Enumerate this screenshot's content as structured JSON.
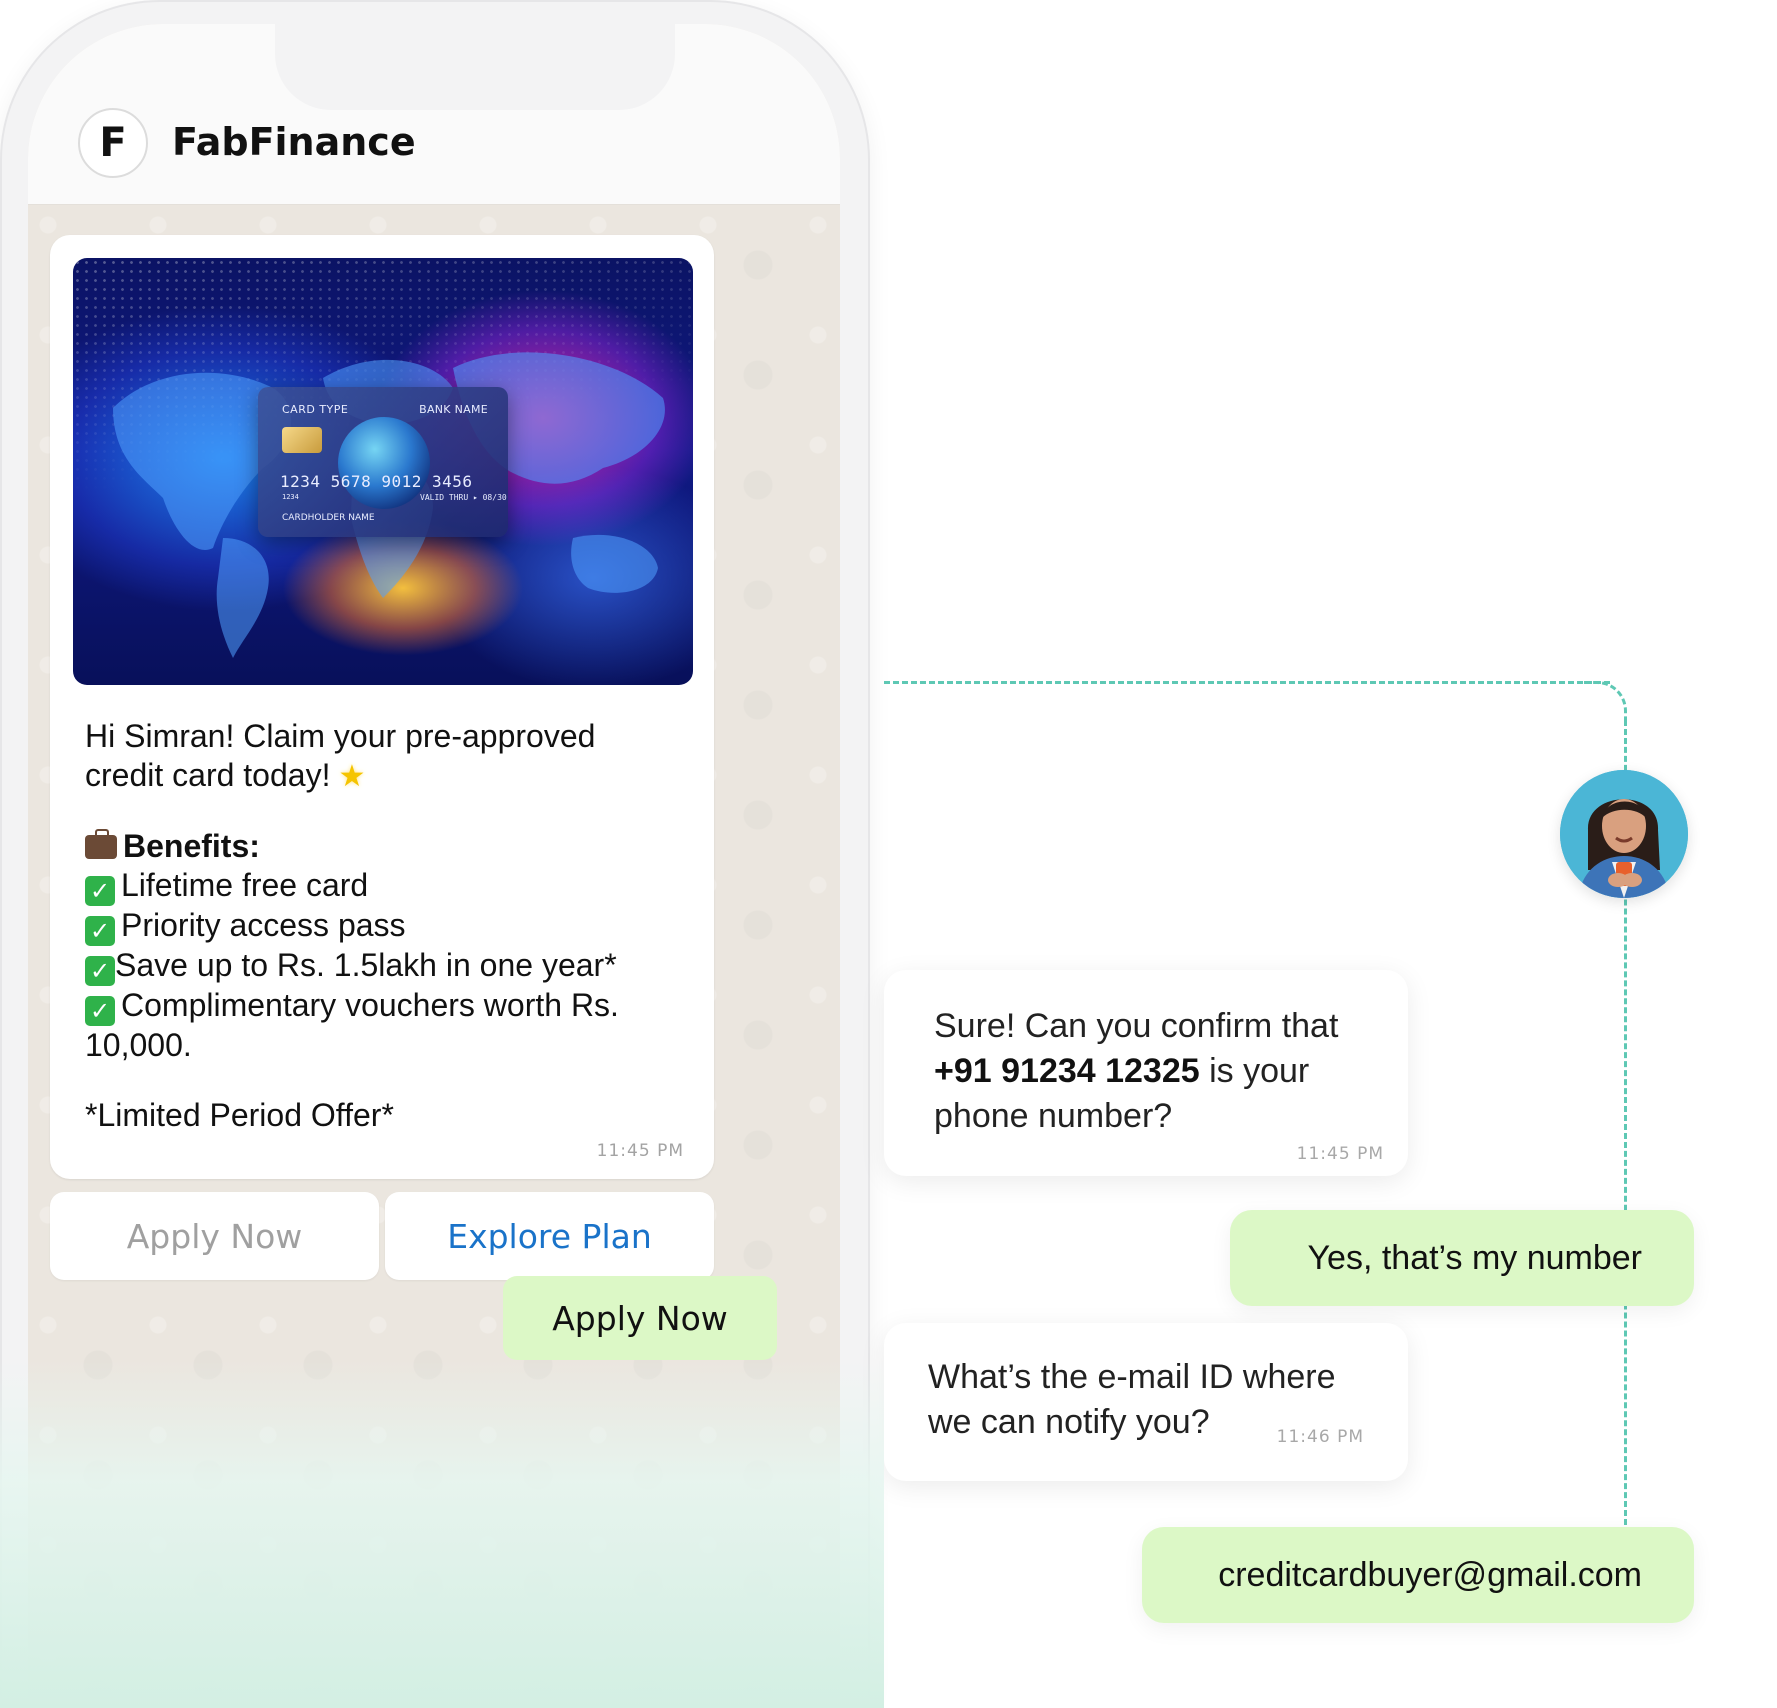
{
  "header": {
    "avatar_letter": "F",
    "brand_name": "FabFinance"
  },
  "card_image": {
    "card_type": "CARD TYPE",
    "bank_name": "BANK NAME",
    "number": "1234  5678  9012  3456",
    "sub_number": "1234",
    "valid_thru": "VALID THRU ▸ 08/30",
    "holder": "CARDHOLDER NAME"
  },
  "offer": {
    "greeting_line1": "Hi Simran! Claim your pre-approved",
    "greeting_line2": "credit card today!",
    "benefits_title": "Benefits:",
    "benefits": [
      "Lifetime free card",
      "Priority access pass",
      "Save up to Rs. 1.5lakh in one year*",
      "Complimentary vouchers worth Rs."
    ],
    "benefit_cont": "10,000.",
    "limited": "*Limited Period Offer*",
    "time": "11:45 PM"
  },
  "buttons": {
    "apply_now": "Apply Now",
    "explore_plan": "Explore Plan"
  },
  "sent_apply": "Apply Now",
  "conversation": {
    "bot_1": {
      "line1": "Sure! Can you confirm that",
      "phone": "+91 91234 12325",
      "line2_rest": " is your",
      "line3": "phone number?",
      "time": "11:45 PM"
    },
    "user_1": "Yes, that’s my number",
    "bot_2": {
      "line1": "What’s the e-mail ID where",
      "line2": "we can notify you?",
      "time": "11:46 PM"
    },
    "user_2": "creditcardbuyer@gmail.com"
  },
  "colors": {
    "sent_bubble": "#dcf8c6",
    "link_blue": "#1a73c9",
    "connector": "#5ec8b4",
    "check_green": "#2fb24a"
  }
}
